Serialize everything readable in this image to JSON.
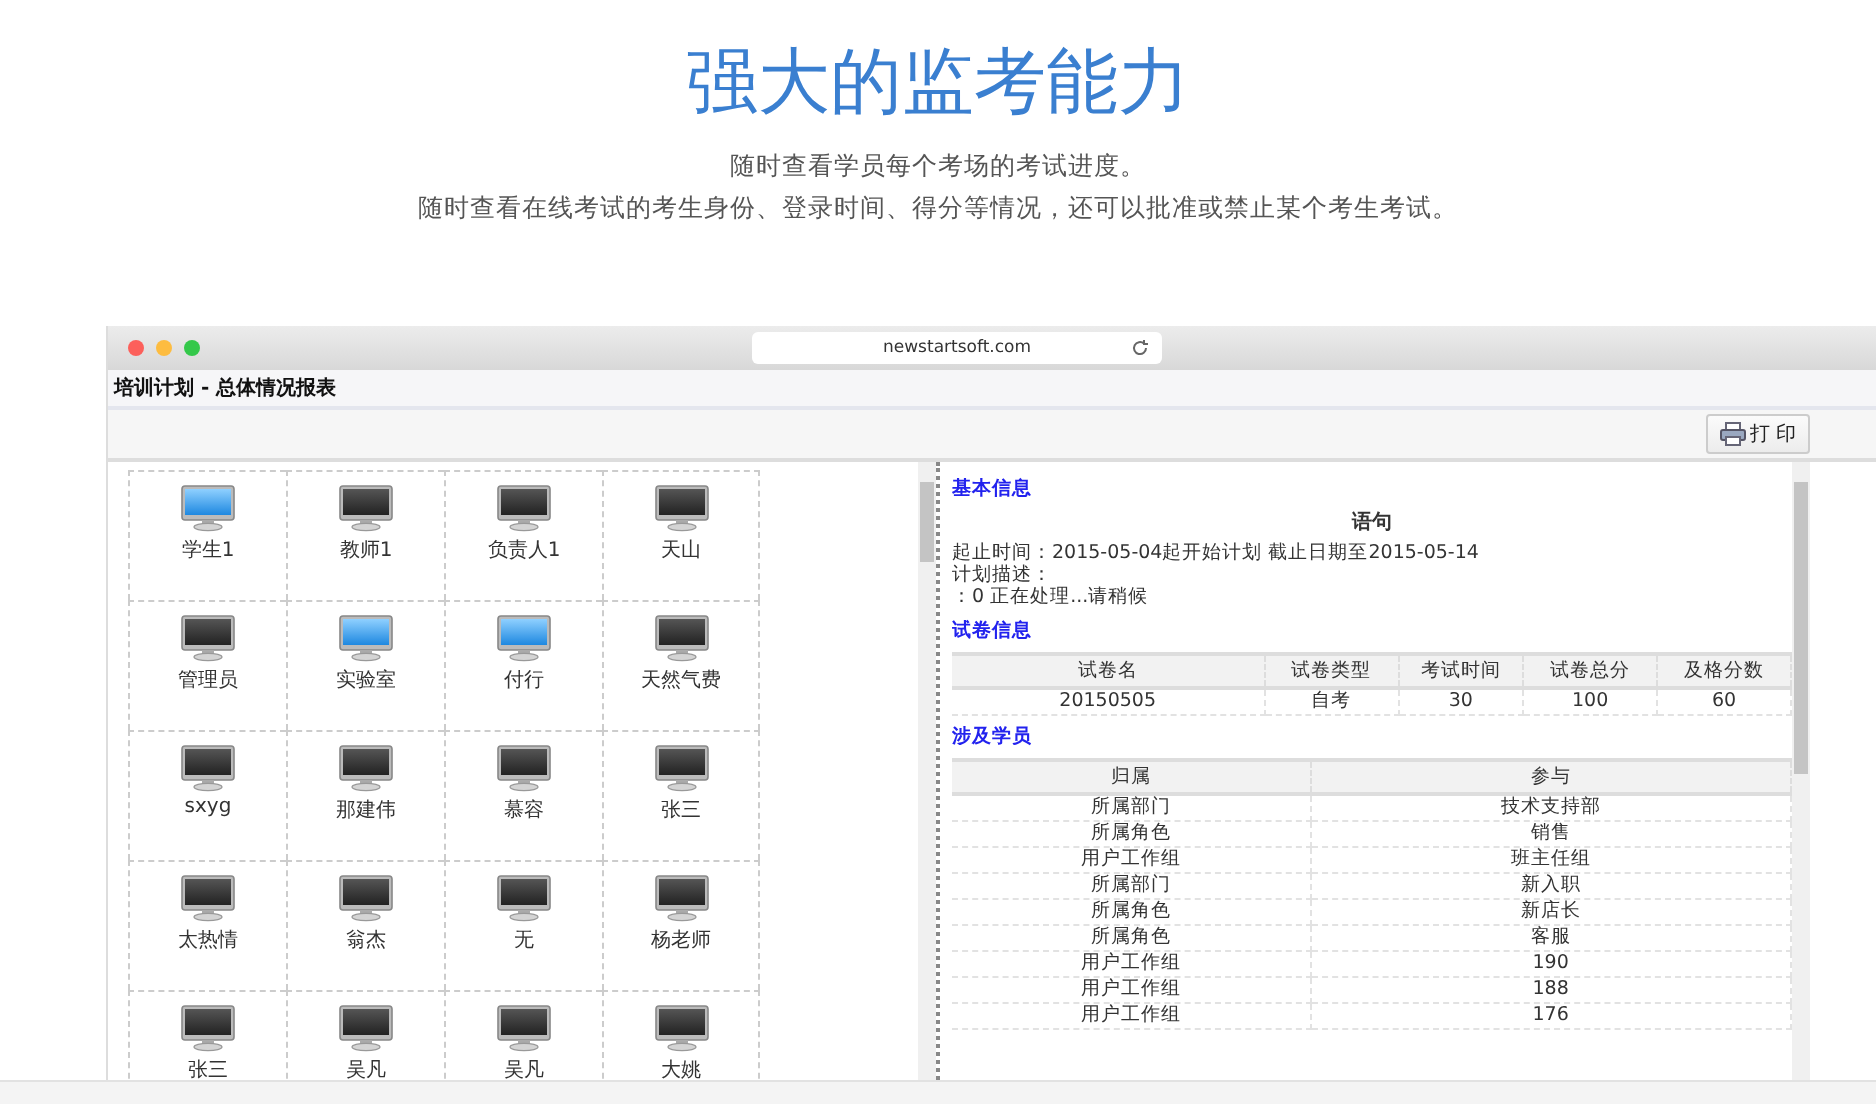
{
  "header": {
    "title": "强大的监考能力",
    "lines": [
      "随时查看学员每个考场的考试进度。",
      "随时查看在线考试的考生身份、登录时间、得分等情况，还可以批准或禁止某个考生考试。"
    ]
  },
  "browser": {
    "url": "newstartsoft.com"
  },
  "app": {
    "title": "培训计划 - 总体情况报表",
    "print_button": "打 印"
  },
  "computers": [
    {
      "name": "学生1",
      "online": true
    },
    {
      "name": "教师1",
      "online": false
    },
    {
      "name": "负责人1",
      "online": false
    },
    {
      "name": "天山",
      "online": false
    },
    {
      "name": "管理员",
      "online": false
    },
    {
      "name": "实验室",
      "online": true
    },
    {
      "name": "付行",
      "online": true
    },
    {
      "name": "天然气费",
      "online": false
    },
    {
      "name": "sxyg",
      "online": false
    },
    {
      "name": "那建伟",
      "online": false
    },
    {
      "name": "慕容",
      "online": false
    },
    {
      "name": "张三",
      "online": false
    },
    {
      "name": "太热情",
      "online": false
    },
    {
      "name": "翁杰",
      "online": false
    },
    {
      "name": "无",
      "online": false
    },
    {
      "name": "杨老师",
      "online": false
    },
    {
      "name": "张三",
      "online": false
    },
    {
      "name": "吴凡",
      "online": false
    },
    {
      "name": "吴凡",
      "online": false
    },
    {
      "name": "大姚",
      "online": false
    }
  ],
  "basic_info": {
    "heading": "基本信息",
    "title": "语句",
    "lines": [
      "起止时间：2015-05-04起开始计划  截止日期至2015-05-14",
      "计划描述：",
      "：0 正在处理...请稍候"
    ]
  },
  "paper_info": {
    "heading": "试卷信息",
    "columns": [
      "试卷名",
      "试卷类型",
      "考试时间",
      "试卷总分",
      "及格分数"
    ],
    "rows": [
      [
        "20150505",
        "自考",
        "30",
        "100",
        "60"
      ]
    ]
  },
  "students": {
    "heading": "涉及学员",
    "columns": [
      "归属",
      "参与"
    ],
    "rows": [
      [
        "所属部门",
        "技术支持部"
      ],
      [
        "所属角色",
        "销售"
      ],
      [
        "用户工作组",
        "班主任组"
      ],
      [
        "所属部门",
        "新入职"
      ],
      [
        "所属角色",
        "新店长"
      ],
      [
        "所属角色",
        "客服"
      ],
      [
        "用户工作组",
        "190"
      ],
      [
        "用户工作组",
        "188"
      ],
      [
        "用户工作组",
        "176"
      ]
    ]
  }
}
